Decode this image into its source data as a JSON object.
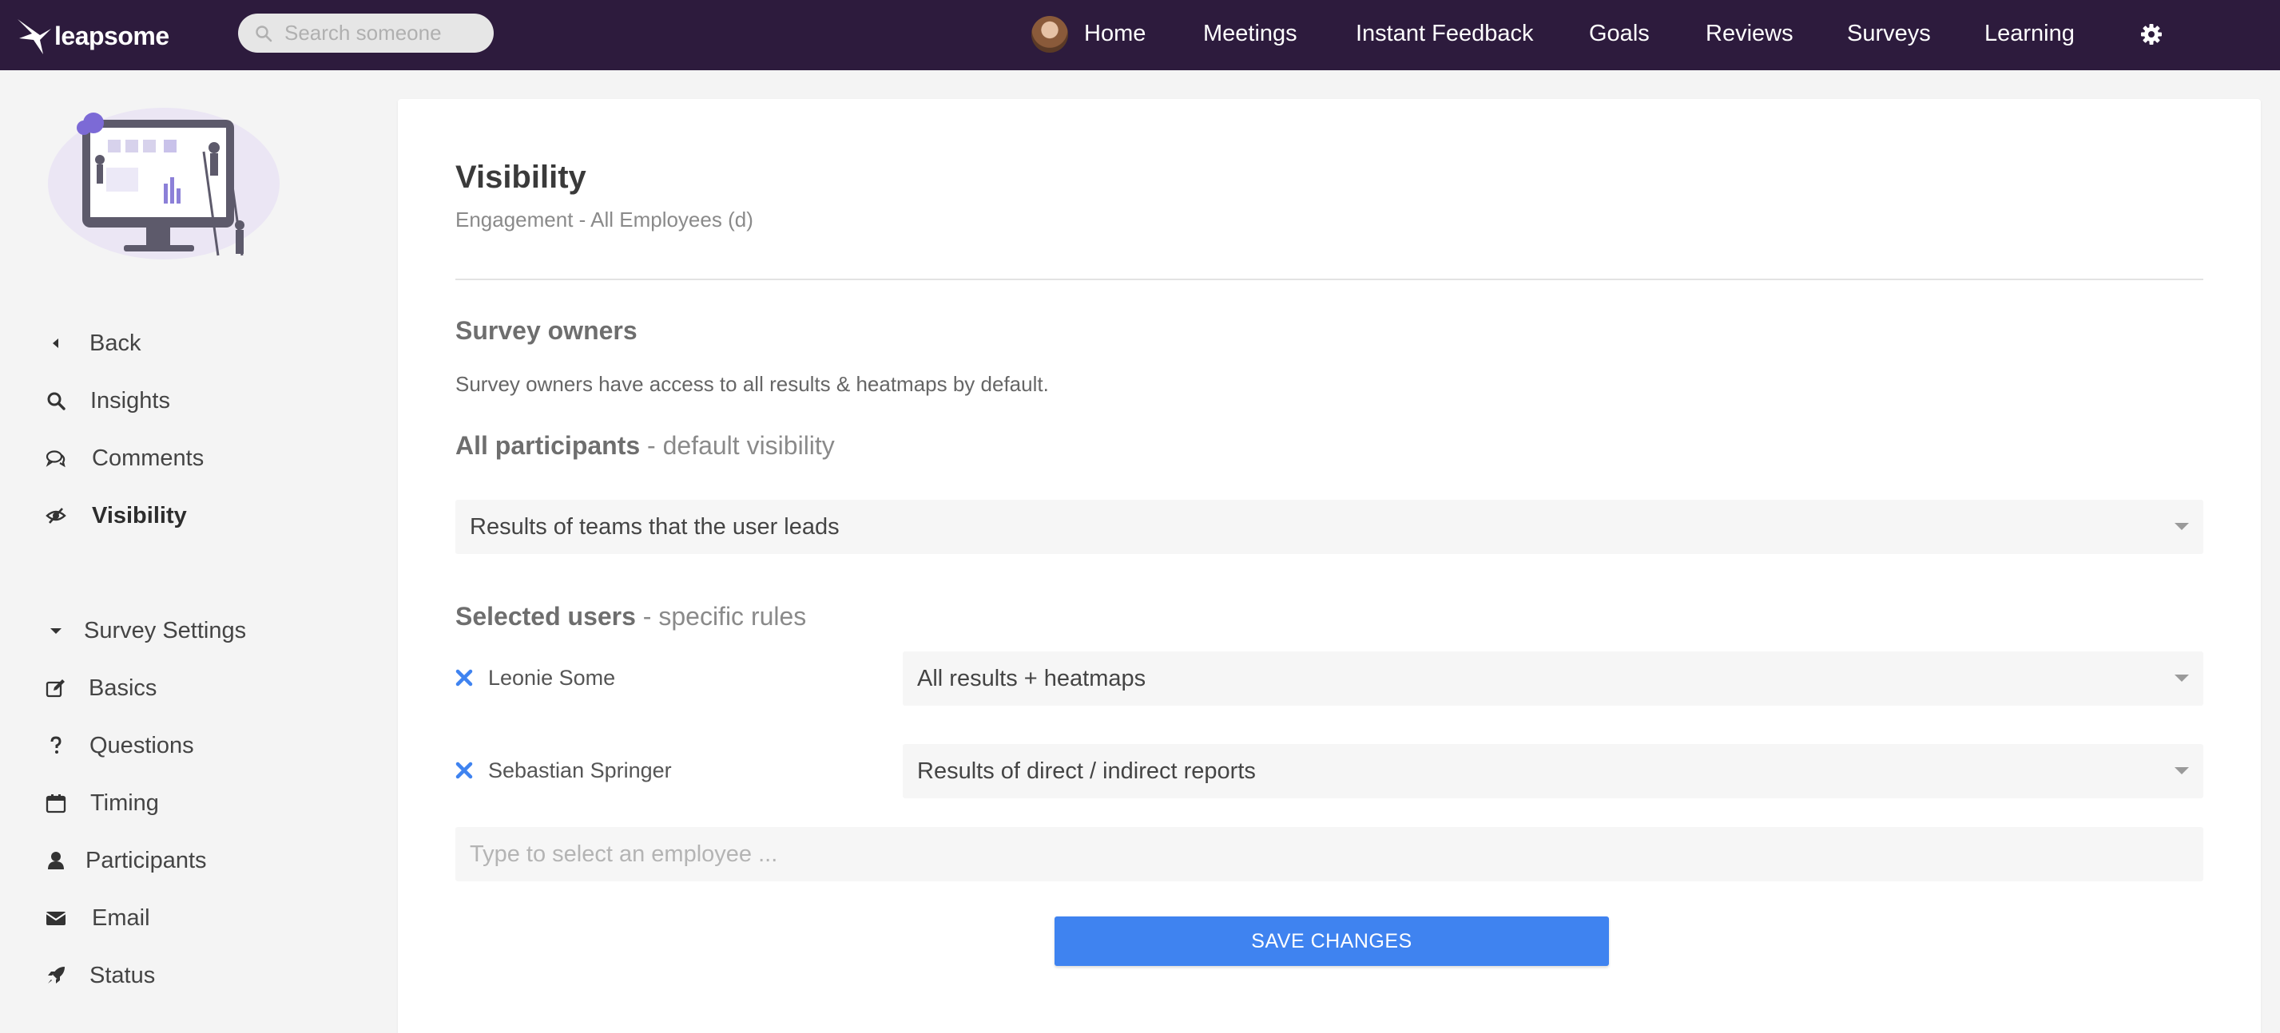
{
  "brand": {
    "name": "leapsome"
  },
  "search": {
    "placeholder": "Search someone"
  },
  "nav": {
    "items": [
      {
        "label": "Home"
      },
      {
        "label": "Meetings"
      },
      {
        "label": "Instant Feedback"
      },
      {
        "label": "Goals"
      },
      {
        "label": "Reviews"
      },
      {
        "label": "Surveys"
      },
      {
        "label": "Learning"
      }
    ]
  },
  "sidebar": {
    "primary": [
      {
        "label": "Back",
        "icon": "caret-left-icon"
      },
      {
        "label": "Insights",
        "icon": "search-icon"
      },
      {
        "label": "Comments",
        "icon": "comments-icon"
      },
      {
        "label": "Visibility",
        "icon": "eye-slash-icon",
        "active": true
      }
    ],
    "settings_header": {
      "label": "Survey Settings",
      "icon": "caret-down-icon"
    },
    "settings": [
      {
        "label": "Basics",
        "icon": "edit-icon"
      },
      {
        "label": "Questions",
        "icon": "question-icon"
      },
      {
        "label": "Timing",
        "icon": "calendar-icon"
      },
      {
        "label": "Participants",
        "icon": "user-icon"
      },
      {
        "label": "Email",
        "icon": "envelope-icon"
      },
      {
        "label": "Status",
        "icon": "rocket-icon"
      }
    ]
  },
  "main": {
    "title": "Visibility",
    "subtitle": "Engagement - All Employees (d)",
    "owners": {
      "title": "Survey owners",
      "description": "Survey owners have access to all results & heatmaps by default."
    },
    "all_participants": {
      "title_bold": "All participants",
      "title_rest": " - default visibility",
      "selected_value": "Results of teams that the user leads"
    },
    "selected_users": {
      "title_bold": "Selected users",
      "title_rest": " - specific rules",
      "rows": [
        {
          "name": "Leonie Some",
          "visibility": "All results + heatmaps"
        },
        {
          "name": "Sebastian Springer",
          "visibility": "Results of direct / indirect reports"
        }
      ],
      "employee_placeholder": "Type to select an employee ..."
    },
    "save_label": "SAVE CHANGES"
  },
  "colors": {
    "topbar": "#2d1b3d",
    "primary": "#3f83f0",
    "remove_icon": "#3f83f0"
  }
}
